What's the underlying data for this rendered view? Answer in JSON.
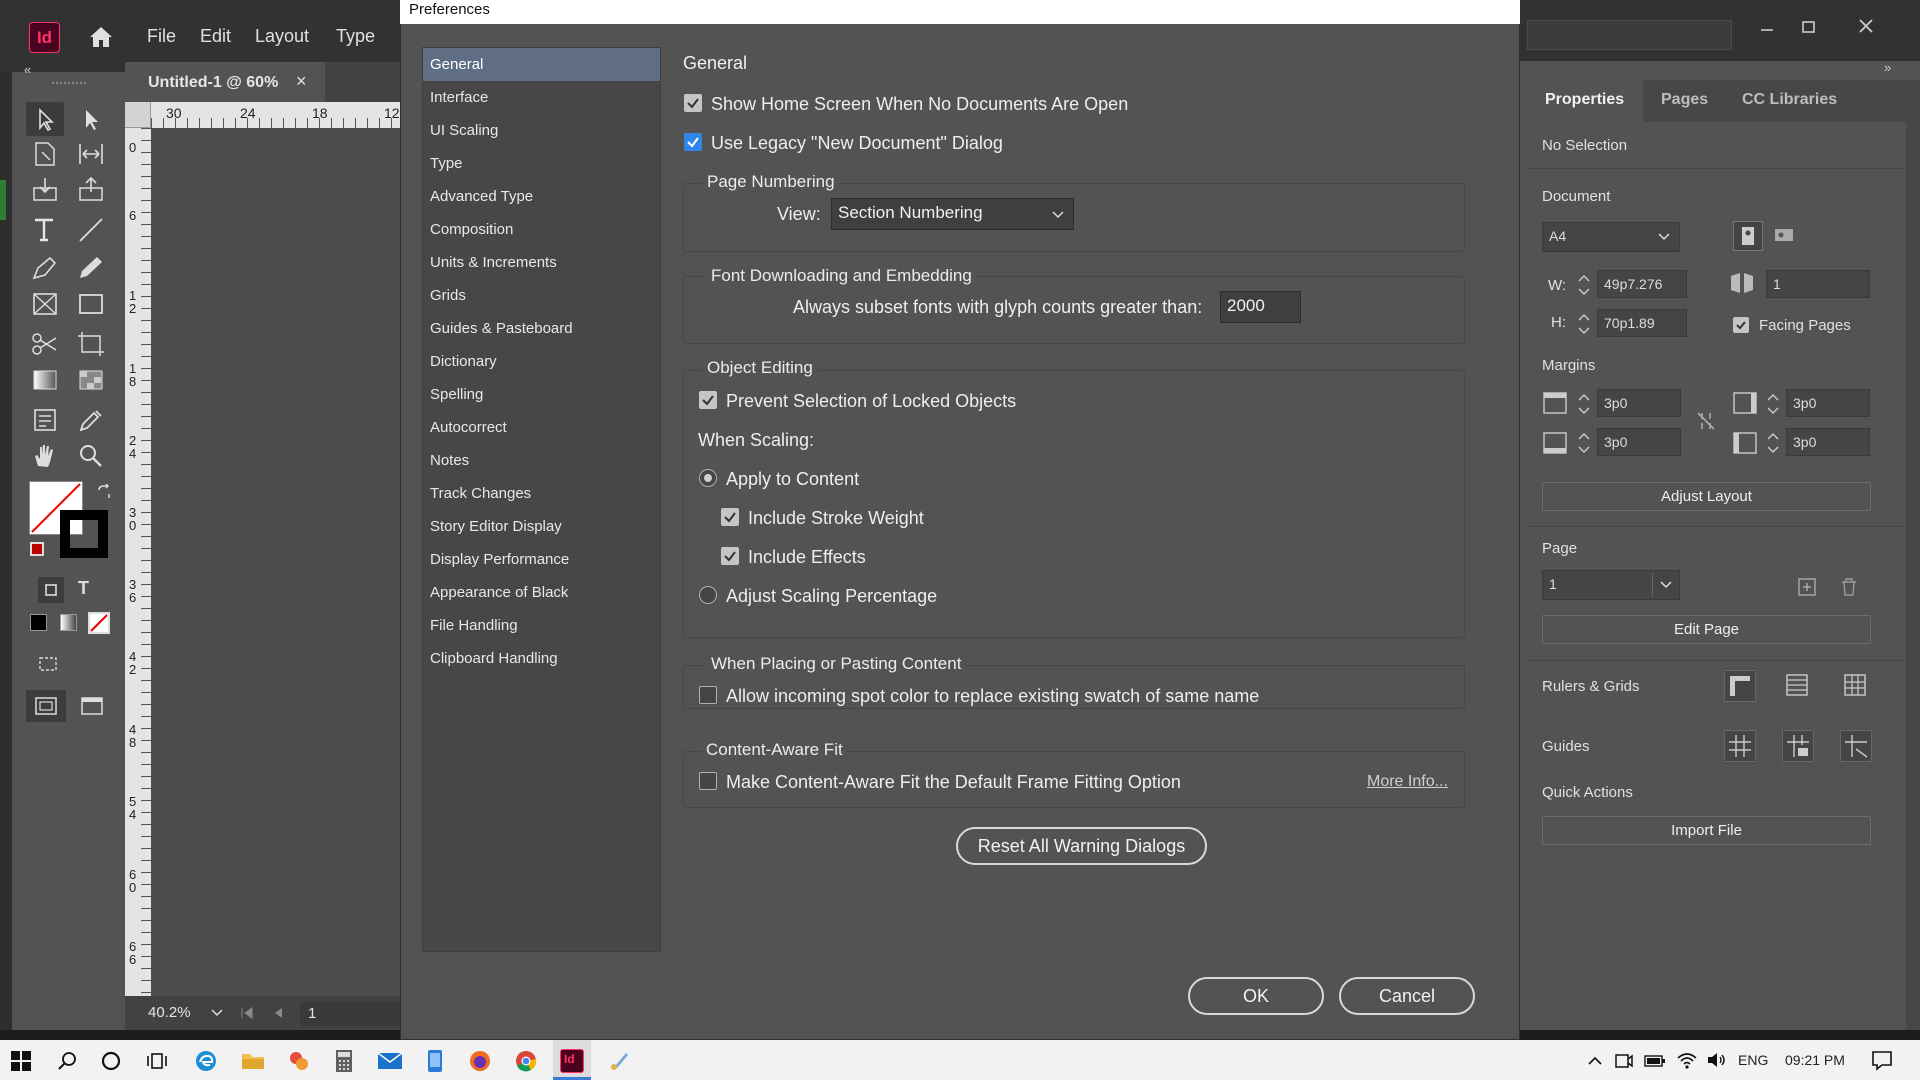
{
  "app": {
    "logo": "Id",
    "menu": [
      "File",
      "Edit",
      "Layout",
      "Type"
    ]
  },
  "document": {
    "tab_title": "Untitled-1 @ 60%",
    "tab_close": "×",
    "ruler_top_ticks": [
      "30",
      "24",
      "18",
      "12"
    ],
    "ruler_left_ticks": [
      "0",
      "6",
      "1 2",
      "1 8",
      "2 4",
      "3 0",
      "3 6",
      "4 2",
      "4 8",
      "5 4",
      "6 0",
      "6 6"
    ],
    "zoom": "40.2%",
    "page_number": "1"
  },
  "dialog": {
    "title": "Preferences",
    "categories": [
      "General",
      "Interface",
      "UI Scaling",
      "Type",
      "Advanced Type",
      "Composition",
      "Units & Increments",
      "Grids",
      "Guides & Pasteboard",
      "Dictionary",
      "Spelling",
      "Autocorrect",
      "Notes",
      "Track Changes",
      "Story Editor Display",
      "Display Performance",
      "Appearance of Black",
      "File Handling",
      "Clipboard Handling"
    ],
    "selected_category": "General",
    "section_title": "General",
    "show_home_screen": {
      "label": "Show Home Screen When No Documents Are Open",
      "checked": true
    },
    "use_legacy_dialog": {
      "label": "Use Legacy \"New Document\" Dialog",
      "checked": true
    },
    "page_numbering": {
      "legend": "Page Numbering",
      "view_label": "View:",
      "view_value": "Section Numbering"
    },
    "font_downloading": {
      "legend": "Font Downloading and Embedding",
      "label": "Always subset fonts with glyph counts greater than:",
      "value": "2000"
    },
    "object_editing": {
      "legend": "Object Editing",
      "prevent_selection": {
        "label": "Prevent Selection of Locked Objects",
        "checked": true
      },
      "when_scaling": "When Scaling:",
      "apply_to_content": {
        "label": "Apply to Content",
        "selected": true
      },
      "include_stroke_weight": {
        "label": "Include Stroke Weight",
        "checked": true
      },
      "include_effects": {
        "label": "Include Effects",
        "checked": true
      },
      "adjust_scaling": {
        "label": "Adjust Scaling Percentage",
        "selected": false
      }
    },
    "placing": {
      "legend": "When Placing or Pasting Content",
      "label": "Allow incoming spot color to replace existing swatch of same name",
      "checked": false
    },
    "content_aware": {
      "legend": "Content-Aware Fit",
      "label": "Make Content-Aware Fit the Default Frame Fitting Option",
      "checked": false,
      "more_info": "More Info..."
    },
    "reset_warnings": "Reset All Warning Dialogs",
    "ok": "OK",
    "cancel": "Cancel"
  },
  "properties_panel": {
    "tabs": [
      "Properties",
      "Pages",
      "CC Libraries"
    ],
    "selection": "No Selection",
    "document_heading": "Document",
    "preset": "A4",
    "width_label": "W:",
    "width": "49p7.276",
    "height_label": "H:",
    "height": "70p1.89",
    "pages_count": "1",
    "facing_pages": {
      "label": "Facing Pages",
      "checked": true
    },
    "margins_heading": "Margins",
    "margin_top": "3p0",
    "margin_bottom": "3p0",
    "margin_inside": "3p0",
    "margin_outside": "3p0",
    "adjust_layout": "Adjust Layout",
    "page_heading": "Page",
    "page_value": "1",
    "edit_page": "Edit Page",
    "rulers_grids": "Rulers & Grids",
    "guides": "Guides",
    "quick_actions": "Quick Actions",
    "import_file": "Import File"
  },
  "taskbar": {
    "language": "ENG",
    "time": "09:21 PM"
  },
  "colors": {
    "accent": "#2f86e8",
    "selection": "#5f6e85",
    "indesign_brand": "#ff3366"
  }
}
